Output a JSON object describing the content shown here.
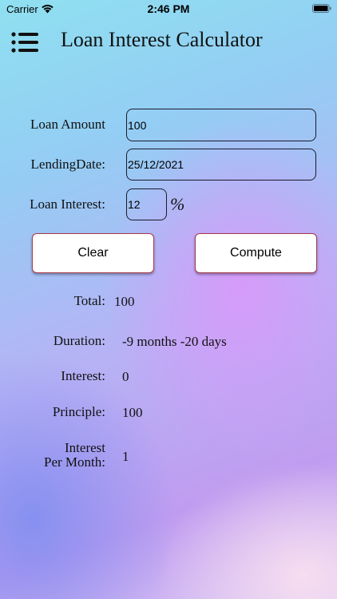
{
  "status_bar": {
    "carrier": "Carrier",
    "time": "2:46 PM"
  },
  "header": {
    "title": "Loan Interest Calculator",
    "menu_icon": "hamburger-menu-icon"
  },
  "form": {
    "loan_amount_label": "Loan Amount",
    "loan_amount_value": "100",
    "lending_date_label": "LendingDate:",
    "lending_date_value": "25/12/2021",
    "loan_interest_label": "Loan Interest:",
    "loan_interest_value": "12",
    "percent_symbol": "%"
  },
  "buttons": {
    "clear_label": "Clear",
    "compute_label": "Compute"
  },
  "results": {
    "total_label": "Total:",
    "total_value": "100",
    "duration_label": "Duration:",
    "duration_value": "-9 months -20 days",
    "interest_label": "Interest:",
    "interest_value": "0",
    "principle_label": "Principle:",
    "principle_value": "100",
    "interest_per_month_label_line1": "Interest",
    "interest_per_month_label_line2": "Per Month:",
    "interest_per_month_value": "1"
  },
  "colors": {
    "button_border": "#a83b4a",
    "field_border": "#1b1b2b"
  }
}
